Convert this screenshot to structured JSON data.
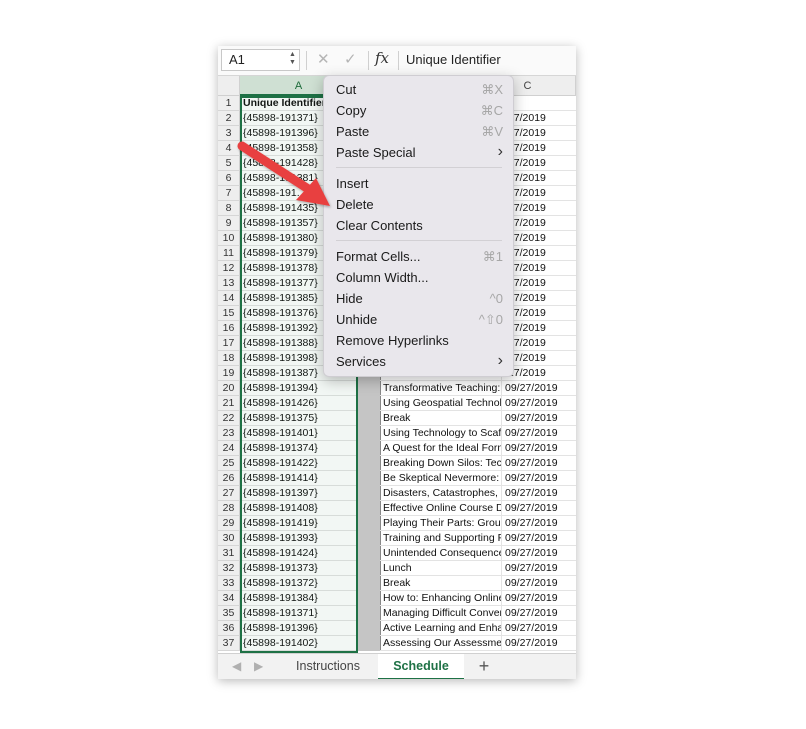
{
  "formula_bar": {
    "name_box": "A1",
    "cancel_icon": "x-icon",
    "enter_icon": "check-icon",
    "fx_label": "fx",
    "content": "Unique Identifier"
  },
  "columns": {
    "a": "A",
    "b": "",
    "c": "C"
  },
  "rows": [
    {
      "n": "1",
      "a": "Unique Identifier",
      "b": "",
      "c": ""
    },
    {
      "n": "2",
      "a": "{45898-191371}",
      "b": "",
      "c": "/27/2019"
    },
    {
      "n": "3",
      "a": "{45898-191396}",
      "b": "",
      "c": "/27/2019"
    },
    {
      "n": "4",
      "a": "{45898-191358}",
      "b": "",
      "c": "/27/2019"
    },
    {
      "n": "5",
      "a": "{45898-191428}",
      "b": "",
      "c": "/27/2019"
    },
    {
      "n": "6",
      "a": "{45898-191381}",
      "b": "",
      "c": "/27/2019"
    },
    {
      "n": "7",
      "a": "{45898-191...",
      "b": "",
      "c": "/27/2019"
    },
    {
      "n": "8",
      "a": "{45898-191435}",
      "b": "",
      "c": "/27/2019"
    },
    {
      "n": "9",
      "a": "{45898-191357}",
      "b": "",
      "c": "/27/2019"
    },
    {
      "n": "10",
      "a": "{45898-191380}",
      "b": "",
      "c": "/27/2019"
    },
    {
      "n": "11",
      "a": "{45898-191379}",
      "b": "",
      "c": "/27/2019"
    },
    {
      "n": "12",
      "a": "{45898-191378}",
      "b": "",
      "c": "/27/2019"
    },
    {
      "n": "13",
      "a": "{45898-191377}",
      "b": "",
      "c": "/27/2019"
    },
    {
      "n": "14",
      "a": "{45898-191385}",
      "b": "",
      "c": "/27/2019"
    },
    {
      "n": "15",
      "a": "{45898-191376}",
      "b": "",
      "c": "/27/2019"
    },
    {
      "n": "16",
      "a": "{45898-191392}",
      "b": "",
      "c": "/27/2019"
    },
    {
      "n": "17",
      "a": "{45898-191388}",
      "b": "",
      "c": "/27/2019"
    },
    {
      "n": "18",
      "a": "{45898-191398}",
      "b": "",
      "c": "/27/2019"
    },
    {
      "n": "19",
      "a": "{45898-191387}",
      "b": "",
      "c": "/27/2019"
    },
    {
      "n": "20",
      "a": "{45898-191394}",
      "b": "Transformative Teaching: T",
      "c": "09/27/2019"
    },
    {
      "n": "21",
      "a": "{45898-191426}",
      "b": "Using Geospatial Technolo",
      "c": "09/27/2019"
    },
    {
      "n": "22",
      "a": "{45898-191375}",
      "b": "Break",
      "c": "09/27/2019"
    },
    {
      "n": "23",
      "a": "{45898-191401}",
      "b": "Using Technology to Scaffo",
      "c": "09/27/2019"
    },
    {
      "n": "24",
      "a": "{45898-191374}",
      "b": "A Quest for the Ideal Forma",
      "c": "09/27/2019"
    },
    {
      "n": "25",
      "a": "{45898-191422}",
      "b": "Breaking Down Silos: Tech",
      "c": "09/27/2019"
    },
    {
      "n": "26",
      "a": "{45898-191414}",
      "b": "Be Skeptical Nevermore: G",
      "c": "09/27/2019"
    },
    {
      "n": "27",
      "a": "{45898-191397}",
      "b": "Disasters, Catastrophes, ar",
      "c": "09/27/2019"
    },
    {
      "n": "28",
      "a": "{45898-191408}",
      "b": "Effective Online Course De",
      "c": "09/27/2019"
    },
    {
      "n": "29",
      "a": "{45898-191419}",
      "b": "Playing Their Parts: Group",
      "c": "09/27/2019"
    },
    {
      "n": "30",
      "a": "{45898-191393}",
      "b": "Training and Supporting Fa",
      "c": "09/27/2019"
    },
    {
      "n": "31",
      "a": "{45898-191424}",
      "b": "Unintended Consequences",
      "c": "09/27/2019"
    },
    {
      "n": "32",
      "a": "{45898-191373}",
      "b": "Lunch",
      "c": "09/27/2019"
    },
    {
      "n": "33",
      "a": "{45898-191372}",
      "b": "Break",
      "c": "09/27/2019"
    },
    {
      "n": "34",
      "a": "{45898-191384}",
      "b": "How to: Enhancing Online",
      "c": "09/27/2019"
    },
    {
      "n": "35",
      "a": "{45898-191371}",
      "b": "Managing Difficult Conver",
      "c": "09/27/2019"
    },
    {
      "n": "36",
      "a": "{45898-191396}",
      "b": "Active Learning and Enhan",
      "c": "09/27/2019"
    },
    {
      "n": "37",
      "a": "{45898-191402}",
      "b": "Assessing Our Assessments",
      "c": "09/27/2019"
    }
  ],
  "context_menu": [
    {
      "label": "Cut",
      "shortcut": "⌘X"
    },
    {
      "label": "Copy",
      "shortcut": "⌘C"
    },
    {
      "label": "Paste",
      "shortcut": "⌘V"
    },
    {
      "label": "Paste Special",
      "shortcut": "›"
    },
    {
      "label": "Insert",
      "shortcut": ""
    },
    {
      "label": "Delete",
      "shortcut": ""
    },
    {
      "label": "Clear Contents",
      "shortcut": ""
    },
    {
      "label": "Format Cells...",
      "shortcut": "⌘1"
    },
    {
      "label": "Column Width...",
      "shortcut": ""
    },
    {
      "label": "Hide",
      "shortcut": "^0"
    },
    {
      "label": "Unhide",
      "shortcut": "^⇧0"
    },
    {
      "label": "Remove Hyperlinks",
      "shortcut": ""
    },
    {
      "label": "Services",
      "shortcut": "›"
    }
  ],
  "sheet_tabs": {
    "tabs": [
      "Instructions",
      "Schedule"
    ],
    "active": "Schedule",
    "add_label": "+"
  },
  "colors": {
    "accent": "#1e7145",
    "annotation_arrow": "#e8413f"
  }
}
